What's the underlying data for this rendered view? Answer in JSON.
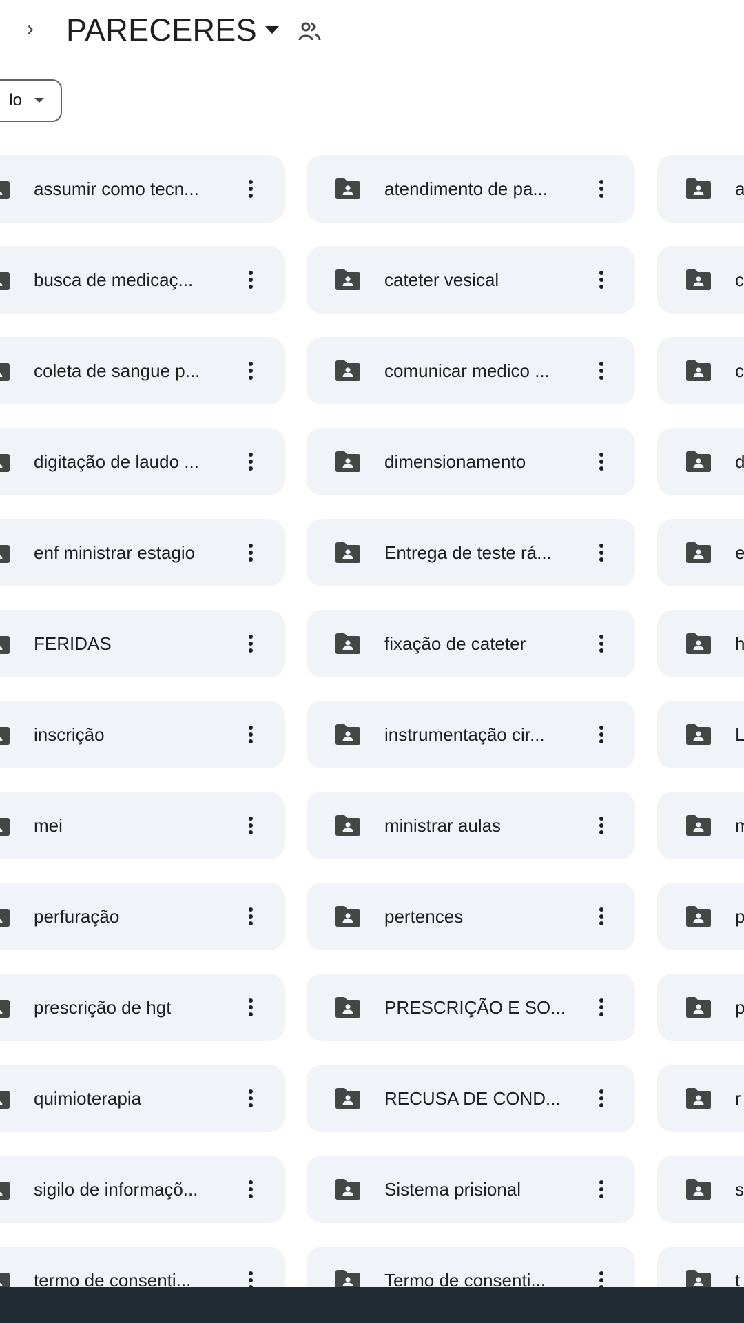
{
  "header": {
    "chevron_glyph": "›",
    "folder_title": "PARECERES",
    "title_caret": "caret-down-icon",
    "shared_icon": "shared-people-icon"
  },
  "filter": {
    "label": "lo",
    "caret": "caret-down-icon"
  },
  "colors": {
    "card_background": "#f0f4f9",
    "folder_icon": "#444746",
    "text": "#1f1f1f",
    "bottom_strip": "#202a33"
  },
  "folders": [
    [
      "assumir como tecn...",
      "atendimento de pa...",
      "a"
    ],
    [
      "busca de medicaç...",
      "cateter vesical",
      "c"
    ],
    [
      "coleta de sangue p...",
      "comunicar medico ...",
      "c"
    ],
    [
      "digitação de laudo ...",
      "dimensionamento",
      "d"
    ],
    [
      "enf ministrar estagio",
      "Entrega de teste rá...",
      "e"
    ],
    [
      "FERIDAS",
      "fixação de cateter",
      "h"
    ],
    [
      "inscrição",
      "instrumentação cir...",
      "L"
    ],
    [
      "mei",
      "ministrar aulas",
      "m"
    ],
    [
      "perfuração",
      "pertences",
      "p"
    ],
    [
      "prescrição de hgt",
      "PRESCRIÇÃO E SO...",
      "p"
    ],
    [
      "quimioterapia",
      "RECUSA DE COND...",
      "r"
    ],
    [
      "sigilo de informaçõ...",
      "Sistema prisional",
      "s"
    ],
    [
      "termo de consenti...",
      "Termo de consenti...",
      "t"
    ]
  ]
}
